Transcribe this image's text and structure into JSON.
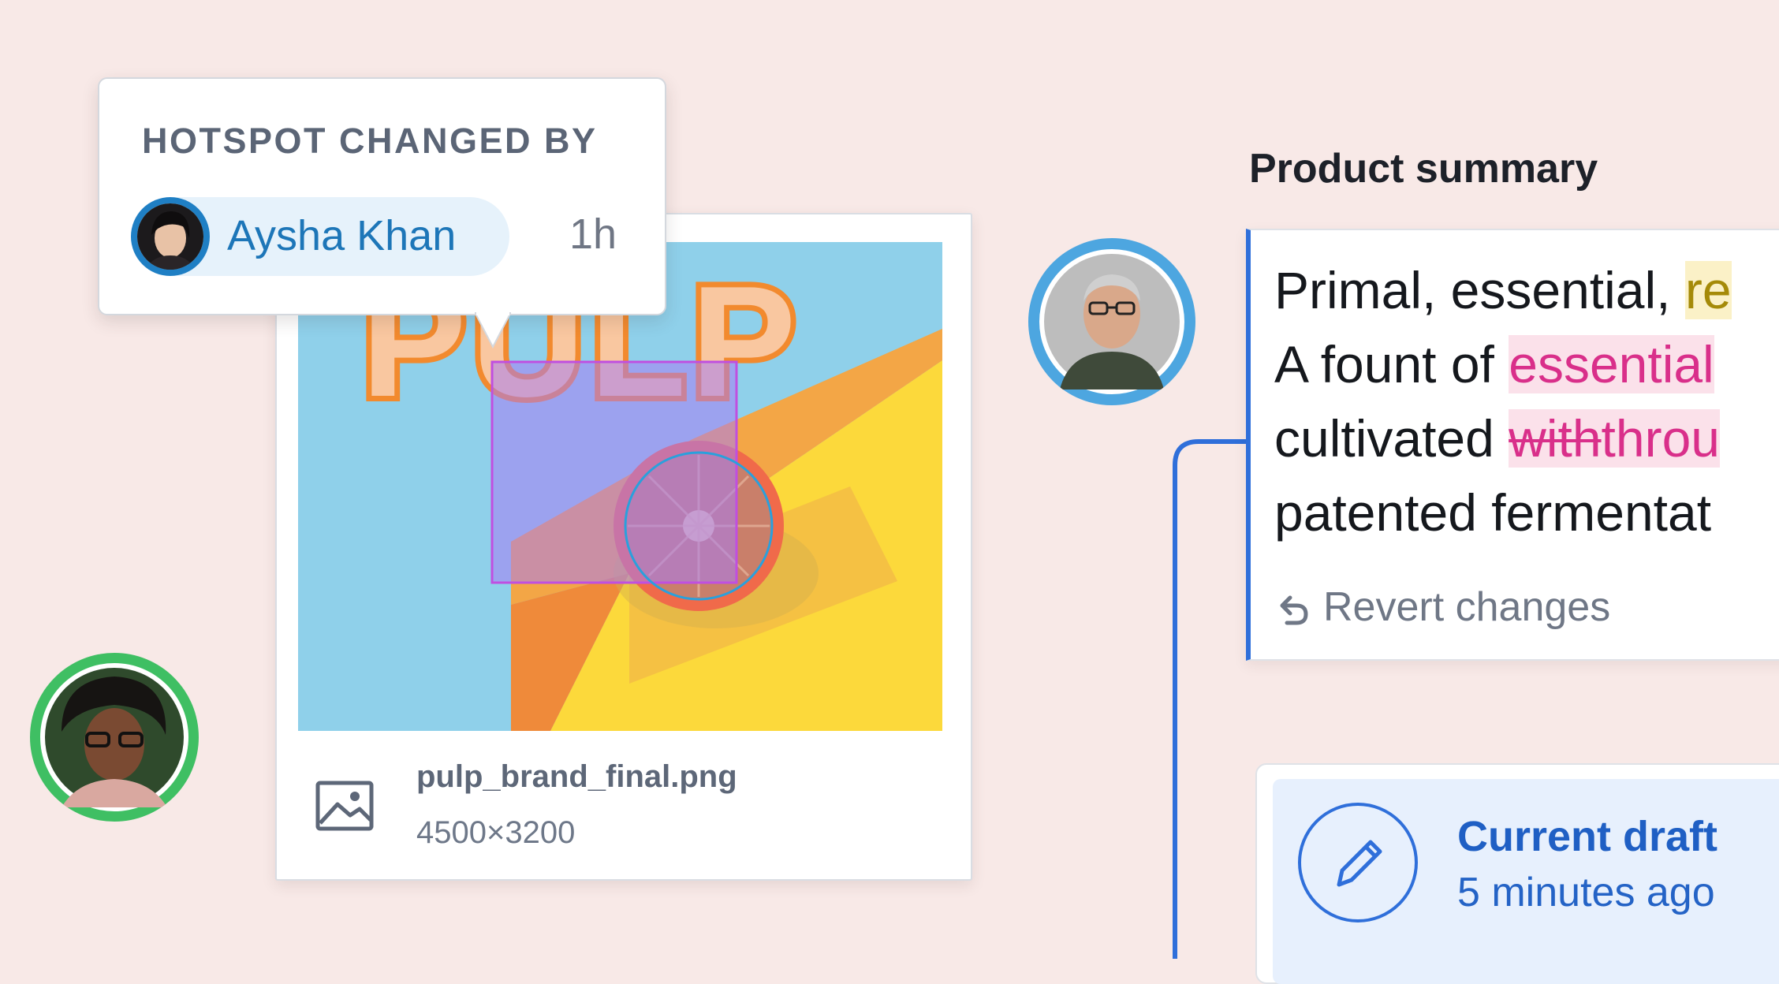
{
  "colors": {
    "background": "#f8e9e7",
    "accent_blue": "#2f6fda",
    "chip_blue": "#1d76b8",
    "hotspot_magenta": "#c04fe0",
    "presence_green": "#3fbf63",
    "presence_blue": "#4da6e0",
    "insert_pink": "#d92f8a",
    "highlight_yellow": "#a58a08"
  },
  "image_card": {
    "brand_text": "PULP",
    "file_name": "pulp_brand_final.png",
    "dimensions": "4500×3200",
    "icon": "image-icon"
  },
  "hotspot_popover": {
    "title": "HOTSPOT CHANGED BY",
    "user": {
      "name": "Aysha Khan",
      "time_ago": "1h"
    }
  },
  "summary": {
    "label": "Product summary",
    "line1_text": "Primal, essential, ",
    "line1_highlight": "re",
    "line2_text": "A fount of ",
    "line2_insert": "essential",
    "line3_text": "cultivated ",
    "line3_deleted": "with",
    "line3_insert": "throu",
    "line4_text": "patented fermentat",
    "revert_label": "Revert changes",
    "revert_icon": "undo-icon"
  },
  "draft": {
    "title": "Current draft",
    "time_ago": "5 minutes ago",
    "icon": "pencil-icon"
  },
  "presence_avatars": [
    "avatar-man",
    "avatar-woman"
  ]
}
